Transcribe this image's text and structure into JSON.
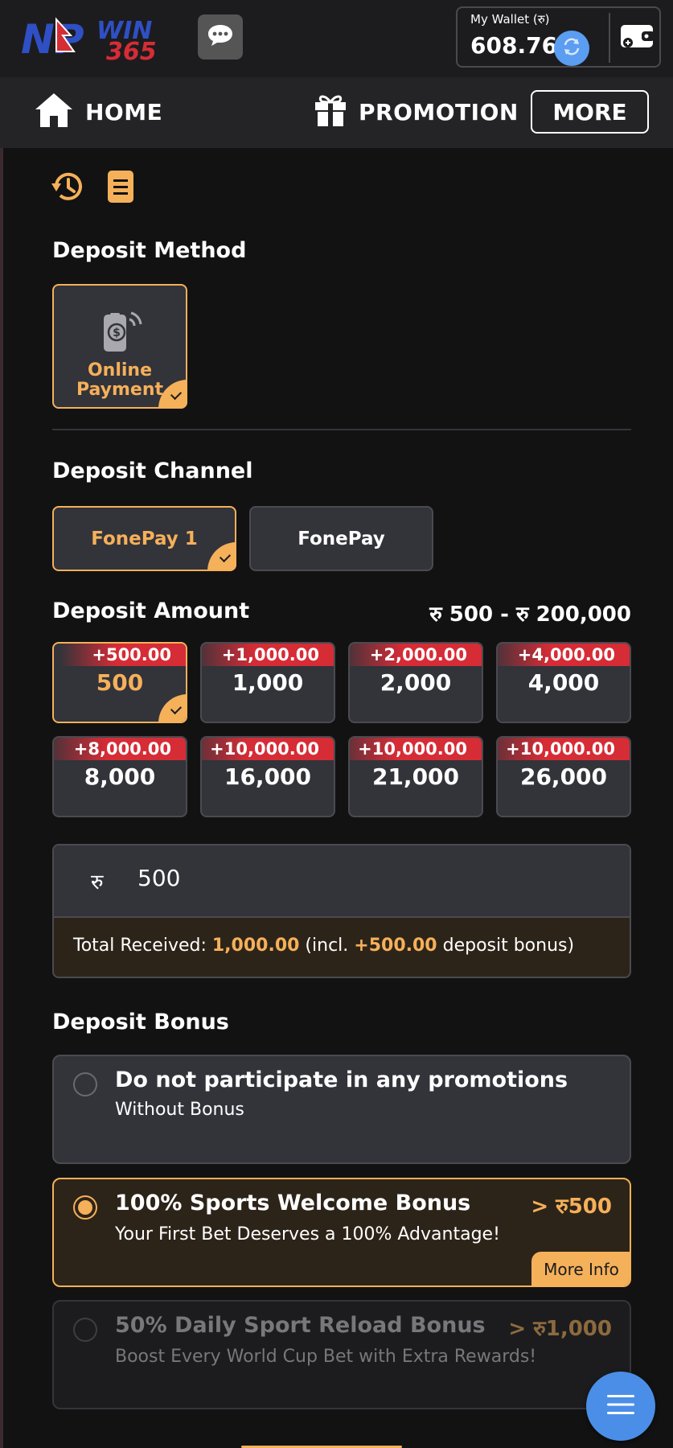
{
  "header": {
    "logo_text_left": "NP",
    "logo_text_win": "WIN",
    "logo_text_num": "365",
    "wallet_label": "My Wallet (रु)",
    "wallet_balance": "608.76"
  },
  "nav": {
    "home_label": "HOME",
    "promotion_label": "PROMOTION",
    "more_label": "MORE"
  },
  "deposit_method": {
    "title": "Deposit Method",
    "methods": [
      {
        "label_line1": "Online",
        "label_line2": "Payment",
        "selected": true
      }
    ]
  },
  "deposit_channel": {
    "title": "Deposit Channel",
    "channels": [
      {
        "label": "FonePay 1",
        "selected": true
      },
      {
        "label": "FonePay",
        "selected": false
      }
    ]
  },
  "deposit_amount": {
    "title": "Deposit Amount",
    "range": "रु 500 - रु 200,000",
    "options": [
      {
        "bonus": "+500.00",
        "value": "500",
        "selected": true
      },
      {
        "bonus": "+1,000.00",
        "value": "1,000",
        "selected": false
      },
      {
        "bonus": "+2,000.00",
        "value": "2,000",
        "selected": false
      },
      {
        "bonus": "+4,000.00",
        "value": "4,000",
        "selected": false
      },
      {
        "bonus": "+8,000.00",
        "value": "8,000",
        "selected": false
      },
      {
        "bonus": "+10,000.00",
        "value": "16,000",
        "selected": false
      },
      {
        "bonus": "+10,000.00",
        "value": "21,000",
        "selected": false
      },
      {
        "bonus": "+10,000.00",
        "value": "26,000",
        "selected": false
      }
    ],
    "input_currency": "रु",
    "input_value": "500",
    "total_prefix": "Total Received: ",
    "total_amount": "1,000.00",
    "total_mid": " (incl. ",
    "total_bonus": "+500.00",
    "total_suffix": " deposit bonus)"
  },
  "deposit_bonus": {
    "title": "Deposit Bonus",
    "options": [
      {
        "title": "Do not participate in any promotions",
        "subtitle": "Without Bonus",
        "min": "",
        "state": "normal"
      },
      {
        "title": "100% Sports Welcome Bonus",
        "subtitle": "Your First Bet Deserves a 100% Advantage!",
        "min": "> रु500",
        "state": "selected",
        "more_info": "More Info"
      },
      {
        "title": "50% Daily Sport Reload Bonus",
        "subtitle": "Boost Every World Cup Bet with Extra Rewards!",
        "min": "> रु1,000",
        "state": "disabled"
      }
    ]
  },
  "colors": {
    "accent": "#f5b05a",
    "bonus_red": "#d62c36",
    "card_bg": "#33333a",
    "page_bg": "#121212",
    "fab_blue": "#4a8ee8"
  }
}
